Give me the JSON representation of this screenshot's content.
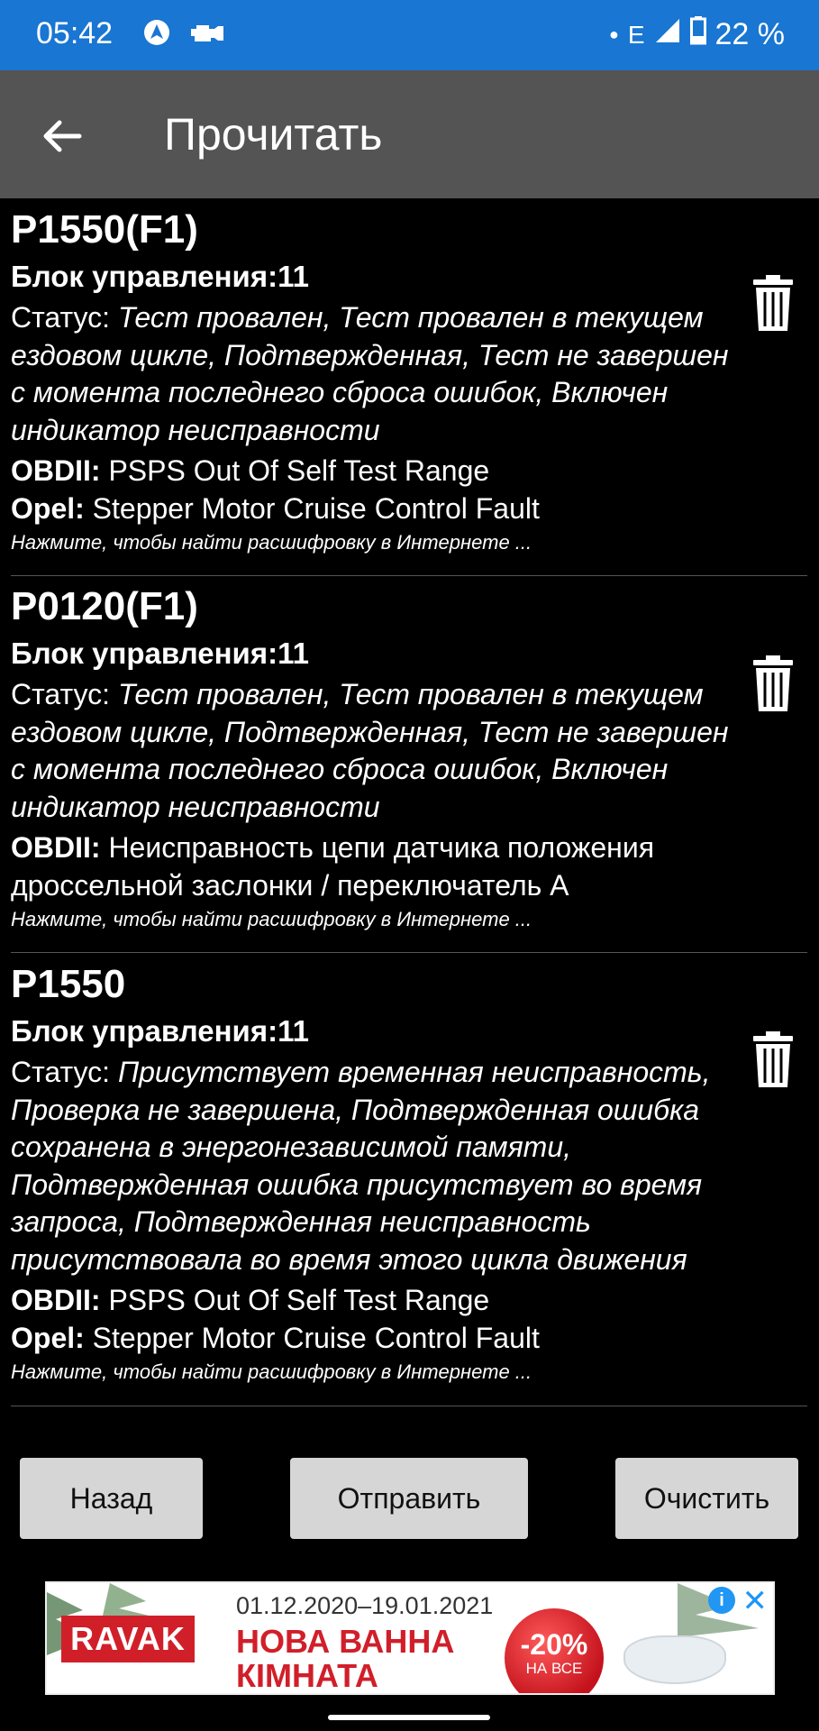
{
  "status_bar": {
    "time": "05:42",
    "network": "E",
    "battery": "22 %"
  },
  "app_bar": {
    "title": "Прочитать"
  },
  "dtcs": [
    {
      "code": "P1550(F1)",
      "block": "Блок управления:11",
      "status_label": "Статус: ",
      "status": "Тест провален, Тест провален в текущем ездовом цикле, Подтвержденная, Тест не завершен с момента последнего сброса ошибок, Включен индикатор неисправности",
      "lines": [
        {
          "label": "OBDII:",
          "text": " PSPS Out Of Self Test Range"
        },
        {
          "label": "Opel:",
          "text": " Stepper Motor Cruise Control Fault"
        }
      ],
      "link": "Нажмите, чтобы найти расшифровку в Интернете ..."
    },
    {
      "code": "P0120(F1)",
      "block": "Блок управления:11",
      "status_label": "Статус: ",
      "status": "Тест провален, Тест провален в текущем ездовом цикле, Подтвержденная, Тест не завершен с момента последнего сброса ошибок, Включен индикатор неисправности",
      "lines": [
        {
          "label": "OBDII:",
          "text": " Неисправность цепи датчика положения дроссельной заслонки / переключатель А"
        }
      ],
      "link": "Нажмите, чтобы найти расшифровку в Интернете ..."
    },
    {
      "code": "P1550",
      "block": "Блок управления:11",
      "status_label": "Статус: ",
      "status": "Присутствует временная неисправность, Проверка не завершена, Подтвержденная ошибка сохранена в энергонезависимой памяти, Подтвержденная ошибка присутствует во время запроса, Подтвержденная неисправность присутствовала во время этого цикла движения",
      "lines": [
        {
          "label": "OBDII:",
          "text": " PSPS Out Of Self Test Range"
        },
        {
          "label": "Opel:",
          "text": " Stepper Motor Cruise Control Fault"
        }
      ],
      "link": "Нажмите, чтобы найти расшифровку в Интернете ..."
    }
  ],
  "buttons": {
    "back": "Назад",
    "send": "Отправить",
    "clear": "Очистить"
  },
  "ad": {
    "brand": "RAVAK",
    "dates": "01.12.2020–19.01.2021",
    "headline1": "НОВА ВАННА",
    "headline2": "КІМНАТА",
    "discount": "-20%",
    "discount_sub": "НА ВСЕ",
    "accent_color": "#d11f2a"
  },
  "colors": {
    "status_bar": "#1976d2",
    "app_bar": "#545454",
    "background": "#000000",
    "button": "#d6d6d6"
  }
}
